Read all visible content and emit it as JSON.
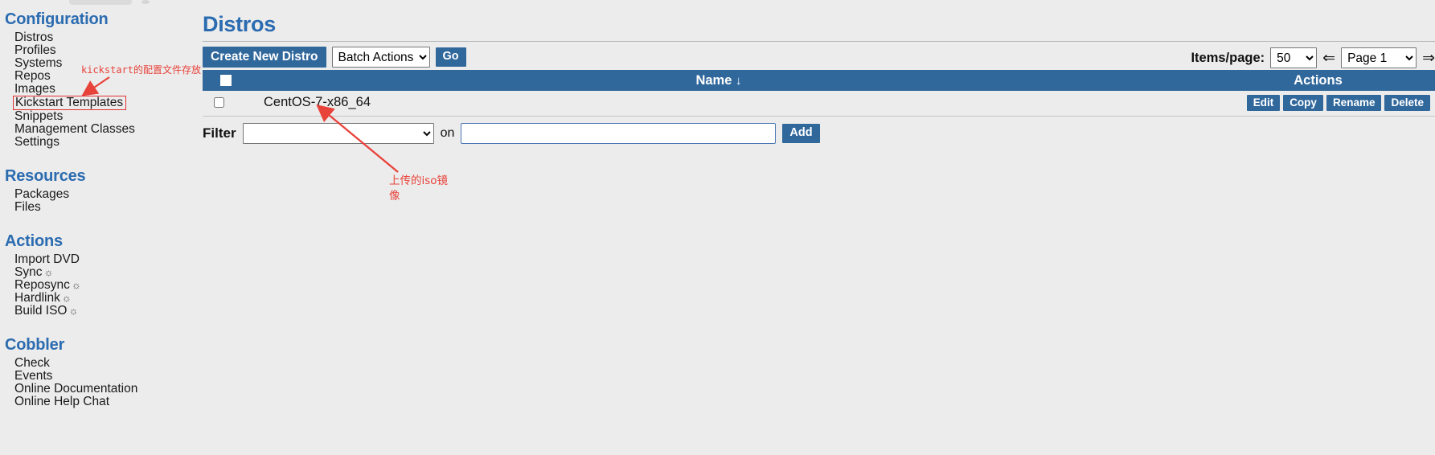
{
  "sidebar": {
    "sections": [
      {
        "title": "Configuration",
        "items": [
          {
            "label": "Distros",
            "highlighted": false
          },
          {
            "label": "Profiles",
            "highlighted": false
          },
          {
            "label": "Systems",
            "highlighted": false
          },
          {
            "label": "Repos",
            "highlighted": false
          },
          {
            "label": "Images",
            "highlighted": false
          },
          {
            "label": "Kickstart Templates",
            "highlighted": true
          },
          {
            "label": "Snippets",
            "highlighted": false
          },
          {
            "label": "Management Classes",
            "highlighted": false
          },
          {
            "label": "Settings",
            "highlighted": false
          }
        ]
      },
      {
        "title": "Resources",
        "items": [
          {
            "label": "Packages",
            "highlighted": false
          },
          {
            "label": "Files",
            "highlighted": false
          }
        ]
      },
      {
        "title": "Actions",
        "items": [
          {
            "label": "Import DVD",
            "highlighted": false,
            "gear": false
          },
          {
            "label": "Sync",
            "highlighted": false,
            "gear": true
          },
          {
            "label": "Reposync",
            "highlighted": false,
            "gear": true
          },
          {
            "label": "Hardlink",
            "highlighted": false,
            "gear": true
          },
          {
            "label": "Build ISO",
            "highlighted": false,
            "gear": true
          }
        ]
      },
      {
        "title": "Cobbler",
        "items": [
          {
            "label": "Check",
            "highlighted": false
          },
          {
            "label": "Events",
            "highlighted": false
          },
          {
            "label": "Online Documentation",
            "highlighted": false
          },
          {
            "label": "Online Help Chat",
            "highlighted": false
          }
        ]
      }
    ]
  },
  "annotations": {
    "top": "kickstart的配置文件存放",
    "bottom": "上传的iso镜像",
    "color": "#e8433b"
  },
  "main": {
    "title": "Distros",
    "toolbar": {
      "create_button": "Create New Distro",
      "batch_actions_selected": "Batch Actions",
      "batch_actions_options": [
        "Batch Actions"
      ],
      "go_button": "Go",
      "items_per_page_label": "Items/page:",
      "items_per_page_value": "50",
      "items_per_page_options": [
        "50"
      ],
      "prev_arrow": "⇐",
      "page_selected": "Page 1",
      "page_options": [
        "Page 1"
      ],
      "next_arrow": "⇒"
    },
    "table": {
      "columns": {
        "name": "Name",
        "sort_indicator": "↓",
        "actions": "Actions"
      },
      "rows": [
        {
          "name": "CentOS-7-x86_64",
          "actions": [
            "Edit",
            "Copy",
            "Rename",
            "Delete"
          ]
        }
      ]
    },
    "filter": {
      "label": "Filter",
      "field_selected": "",
      "field_options": [
        ""
      ],
      "on_label": "on",
      "value": "",
      "value_placeholder": "",
      "add_button": "Add"
    }
  },
  "colors": {
    "accent_blue": "#31689c",
    "heading_blue": "#2b6cb0",
    "background": "#ececec",
    "annotation_red": "#e8433b"
  }
}
